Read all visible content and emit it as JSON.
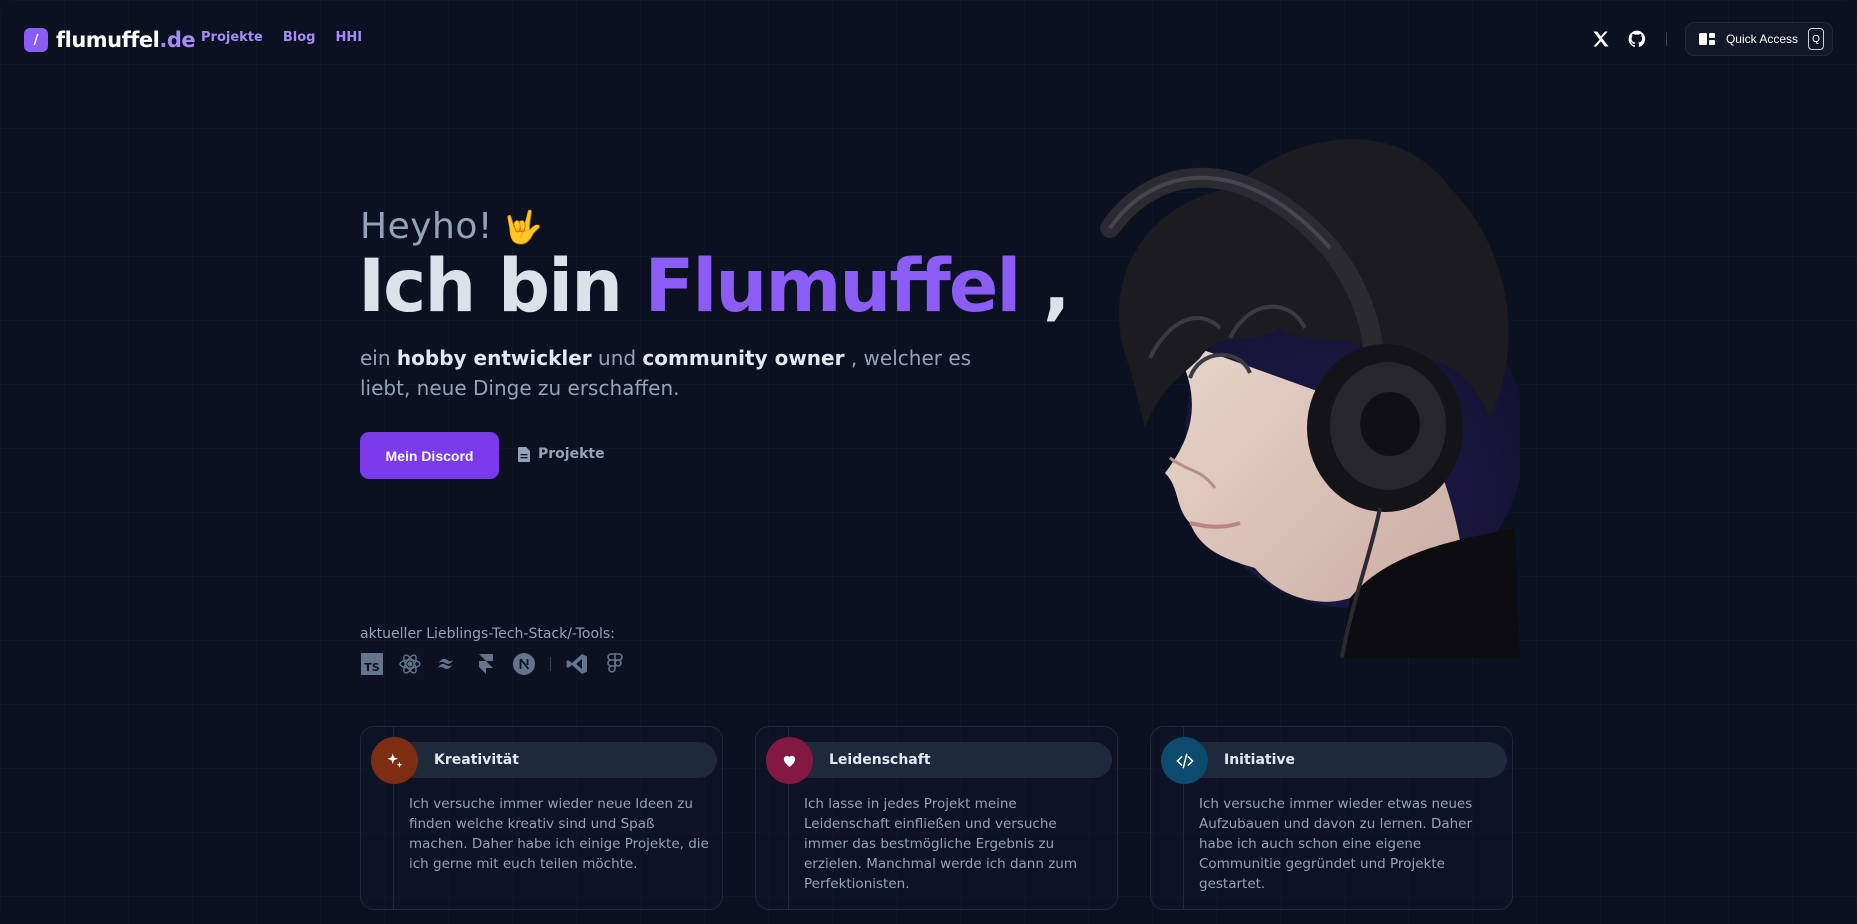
{
  "nav": {
    "logo_badge": "/",
    "logo_name": "flumuffel",
    "logo_tld": ".de",
    "links": [
      "Projekte",
      "Blog",
      "HHI"
    ],
    "social": [
      "x-icon",
      "github-icon"
    ],
    "quick_access_label": "Quick Access",
    "quick_access_key": "Q"
  },
  "hero": {
    "greeting": "Heyho!",
    "greeting_emoji": "🤟",
    "headline_prefix": "Ich bin",
    "headline_name": "Flumuffel",
    "headline_suffix": ",",
    "sub_1": "ein",
    "sub_b1": "hobby entwickler",
    "sub_2": "und",
    "sub_b2": "community owner",
    "sub_3": ", welcher es liebt, neue Dinge zu erschaffen.",
    "primary_button": "Mein Discord",
    "secondary_button": "Projekte"
  },
  "stack": {
    "label": "aktueller Lieblings-Tech-Stack/-Tools:",
    "tools": [
      "typescript-icon",
      "react-icon",
      "tailwind-icon",
      "framer-icon",
      "nextjs-icon",
      "vscode-icon",
      "figma-icon"
    ]
  },
  "cards": [
    {
      "title": "Kreativität",
      "icon": "sparkles-icon",
      "color": "#7c2d12",
      "text": "Ich versuche immer wieder neue Ideen zu finden welche kreativ sind und Spaß machen. Daher habe ich einige Projekte, die ich gerne mit euch teilen möchte."
    },
    {
      "title": "Leidenschaft",
      "icon": "heart-icon",
      "color": "#831843",
      "text": "Ich lasse in jedes Projekt meine Leidenschaft einfließen und versuche immer das bestmögliche Ergebnis zu erzielen. Manchmal werde ich dann zum Perfektionisten."
    },
    {
      "title": "Initiative",
      "icon": "code-icon",
      "color": "#0c4a6e",
      "text": "Ich versuche immer wieder etwas neues Aufzubauen und davon zu lernen. Daher habe ich auch schon eine eigene Communitie gegründet und Projekte gestartet."
    }
  ]
}
